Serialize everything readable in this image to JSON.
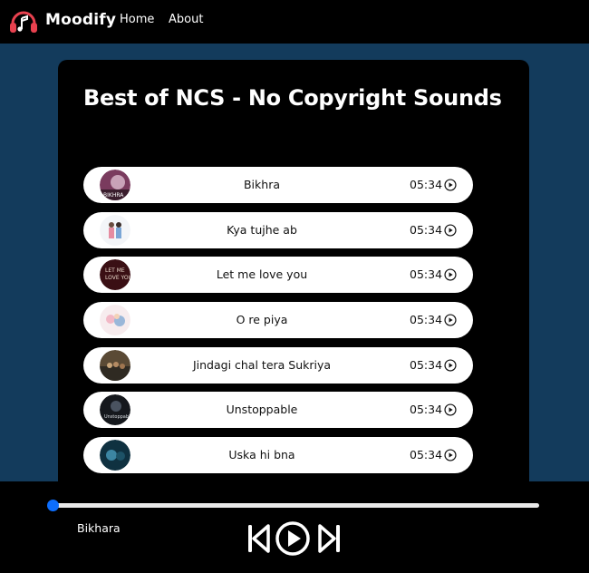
{
  "navbar": {
    "brand": "Moodify",
    "links": [
      {
        "label": "Home"
      },
      {
        "label": "About"
      }
    ]
  },
  "playlist": {
    "title": "Best of NCS - No Copyright Sounds",
    "songs": [
      {
        "name": "Bikhra",
        "time": "05:34"
      },
      {
        "name": "Kya tujhe ab",
        "time": "05:34"
      },
      {
        "name": "Let me love you",
        "time": "05:34"
      },
      {
        "name": "O re piya",
        "time": "05:34"
      },
      {
        "name": "Jindagi chal tera Sukriya",
        "time": "05:34"
      },
      {
        "name": "Unstoppable",
        "time": "05:34"
      },
      {
        "name": "Uska hi bna",
        "time": "05:34"
      }
    ]
  },
  "player": {
    "now_playing": "Bikhara",
    "progress": 0
  },
  "colors": {
    "page_bg": "#133b5c",
    "accent": "#0d6efd",
    "logo_red": "#e8414f"
  },
  "icons": {
    "logo": "headphones-music-note-icon",
    "song_play": "play-circle-icon",
    "prev": "skip-start-icon",
    "play": "play-circle-icon",
    "next": "skip-end-icon"
  }
}
